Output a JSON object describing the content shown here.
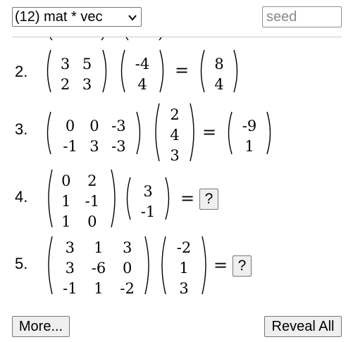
{
  "header": {
    "topic_selected": "(12) mat * vec",
    "seed_placeholder": "seed"
  },
  "problems": [
    {
      "number": "2.",
      "matrix": [
        [
          "3",
          "5"
        ],
        [
          "2",
          "3"
        ]
      ],
      "vector": [
        "-4",
        "4"
      ],
      "equals": "=",
      "answer": [
        "8",
        "4"
      ],
      "answer_revealed": true
    },
    {
      "number": "3.",
      "matrix": [
        [
          "0",
          "0",
          "-3"
        ],
        [
          "-1",
          "3",
          "-3"
        ]
      ],
      "vector": [
        "2",
        "4",
        "3"
      ],
      "equals": "=",
      "answer": [
        "-9",
        "1"
      ],
      "answer_revealed": true
    },
    {
      "number": "4.",
      "matrix": [
        [
          "0",
          "2"
        ],
        [
          "1",
          "-1"
        ],
        [
          "1",
          "0"
        ]
      ],
      "vector": [
        "3",
        "-1"
      ],
      "equals": "=",
      "reveal_label": "?",
      "answer_revealed": false
    },
    {
      "number": "5.",
      "matrix": [
        [
          "3",
          "1",
          "3"
        ],
        [
          "3",
          "-6",
          "0"
        ],
        [
          "-1",
          "1",
          "-2"
        ]
      ],
      "vector": [
        "-2",
        "1",
        "3"
      ],
      "equals": "=",
      "reveal_label": "?",
      "answer_revealed": false
    }
  ],
  "footer": {
    "more_label": "More...",
    "reveal_all_label": "Reveal All"
  }
}
